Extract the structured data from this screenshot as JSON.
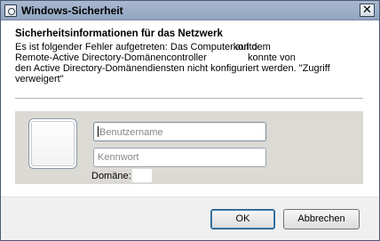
{
  "window": {
    "title": "Windows-Sicherheit",
    "close_glyph": "✕"
  },
  "content": {
    "heading": "Sicherheitsinformationen für das Netzwerk",
    "message_lines": [
      [
        "Es ist folgender Fehler aufgetreten: Das Computerkonto",
        "auf dem"
      ],
      [
        "Remote-Active Directory-Domänencontroller",
        "konnte von"
      ],
      [
        "den Active Directory-Domänendiensten nicht konfiguriert werden. \"Zugriff"
      ],
      [
        "verweigert\""
      ]
    ]
  },
  "credentials": {
    "username_placeholder": "Benutzername",
    "password_placeholder": "Kennwort",
    "domain_label": "Domäne:",
    "domain_value": ""
  },
  "buttons": {
    "ok": "OK",
    "cancel": "Abbrechen"
  }
}
